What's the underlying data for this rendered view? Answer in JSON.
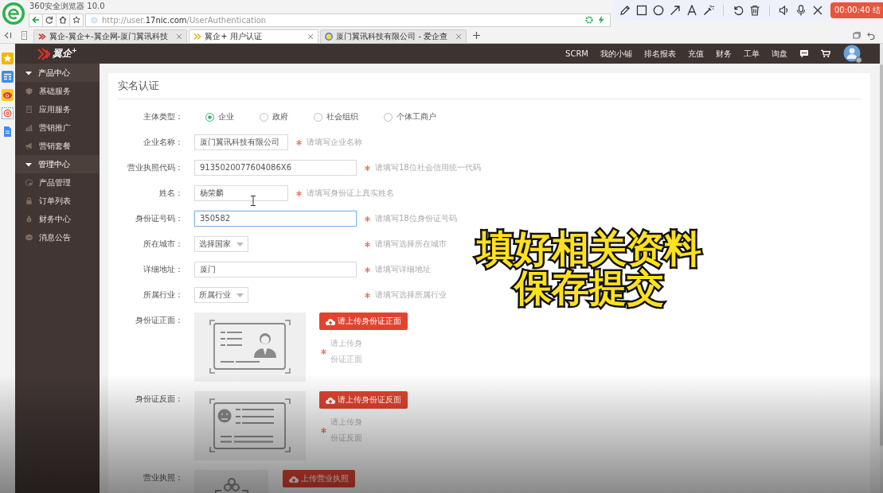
{
  "browser": {
    "title": "360安全浏览器 10.0",
    "url": "http://user.**17nic.com**/UserAuthentication",
    "tabs": [
      {
        "label": "翼企-翼企+-翼企网-厦门翼讯科技",
        "selected": false
      },
      {
        "label": "翼企+ 用户认证",
        "selected": true
      },
      {
        "label": "厦门翼讯科技有限公司 - 爱企查",
        "selected": false
      }
    ]
  },
  "recorder": {
    "timer": "00:00:40 结"
  },
  "header": {
    "logo": "翼企$^{+}$",
    "nav": [
      "SCRM",
      "我的小铺",
      "排名报表",
      "充值",
      "财务",
      "工单",
      "询盘"
    ]
  },
  "sidebar": {
    "sections": [
      {
        "label": "产品中心",
        "expanded": true,
        "children": [
          {
            "label": "基础服务"
          },
          {
            "label": "应用服务"
          },
          {
            "label": "营销推广"
          },
          {
            "label": "营销套餐"
          }
        ]
      },
      {
        "label": "管理中心",
        "expanded": true,
        "children": [
          {
            "label": "产品管理"
          },
          {
            "label": "订单列表"
          },
          {
            "label": "财务中心"
          },
          {
            "label": "消息公告"
          }
        ]
      }
    ]
  },
  "form": {
    "title": "实名认证",
    "fields": [
      {
        "kind": "radio",
        "label": "主体类型：",
        "options": [
          {
            "label": "企业",
            "selected": true
          },
          {
            "label": "政府",
            "selected": false
          },
          {
            "label": "社会组织",
            "selected": false
          },
          {
            "label": "个体工商户",
            "selected": false
          }
        ]
      },
      {
        "kind": "text",
        "label": "企业名称：",
        "value": "厦门翼讯科技有限公司",
        "focused": false,
        "required": true,
        "hint": "请填写企业名称"
      },
      {
        "kind": "text",
        "label": "营业执照代码：",
        "value": "9135020077604086X6",
        "focused": false,
        "required": true,
        "hint": "请填写18位社会信用统一代码"
      },
      {
        "kind": "text",
        "label": "姓名：",
        "value": "杨荣麟",
        "focused": false,
        "required": true,
        "hint": "请填写身份证上真实姓名"
      },
      {
        "kind": "text",
        "label": "身份证号码：",
        "value": "350582",
        "focused": true,
        "required": true,
        "hint": "请填写18位身份证号码"
      },
      {
        "kind": "select",
        "label": "所在城市：",
        "value": "选择国家",
        "required": true,
        "hint": "请填写选择所在城市"
      },
      {
        "kind": "text",
        "label": "详细地址：",
        "value": "厦门",
        "focused": false,
        "required": true,
        "hint": "请填写详细地址"
      },
      {
        "kind": "select",
        "label": "所属行业：",
        "value": "所属行业",
        "required": true,
        "hint": "请填写选择所属行业"
      },
      {
        "kind": "upload",
        "label": "身份证正面：",
        "button": "请上传身份证正面",
        "required": true,
        "hint": "请上传身份证正面"
      },
      {
        "kind": "upload",
        "label": "身份证反面：",
        "button": "请上传身份证反面",
        "required": true,
        "hint": "请上传身份证反面"
      },
      {
        "kind": "upload",
        "label": "营业执照：",
        "button": "上传营业执照"
      }
    ]
  },
  "caption": [
    "填好相关资料",
    "保存提交"
  ]
}
